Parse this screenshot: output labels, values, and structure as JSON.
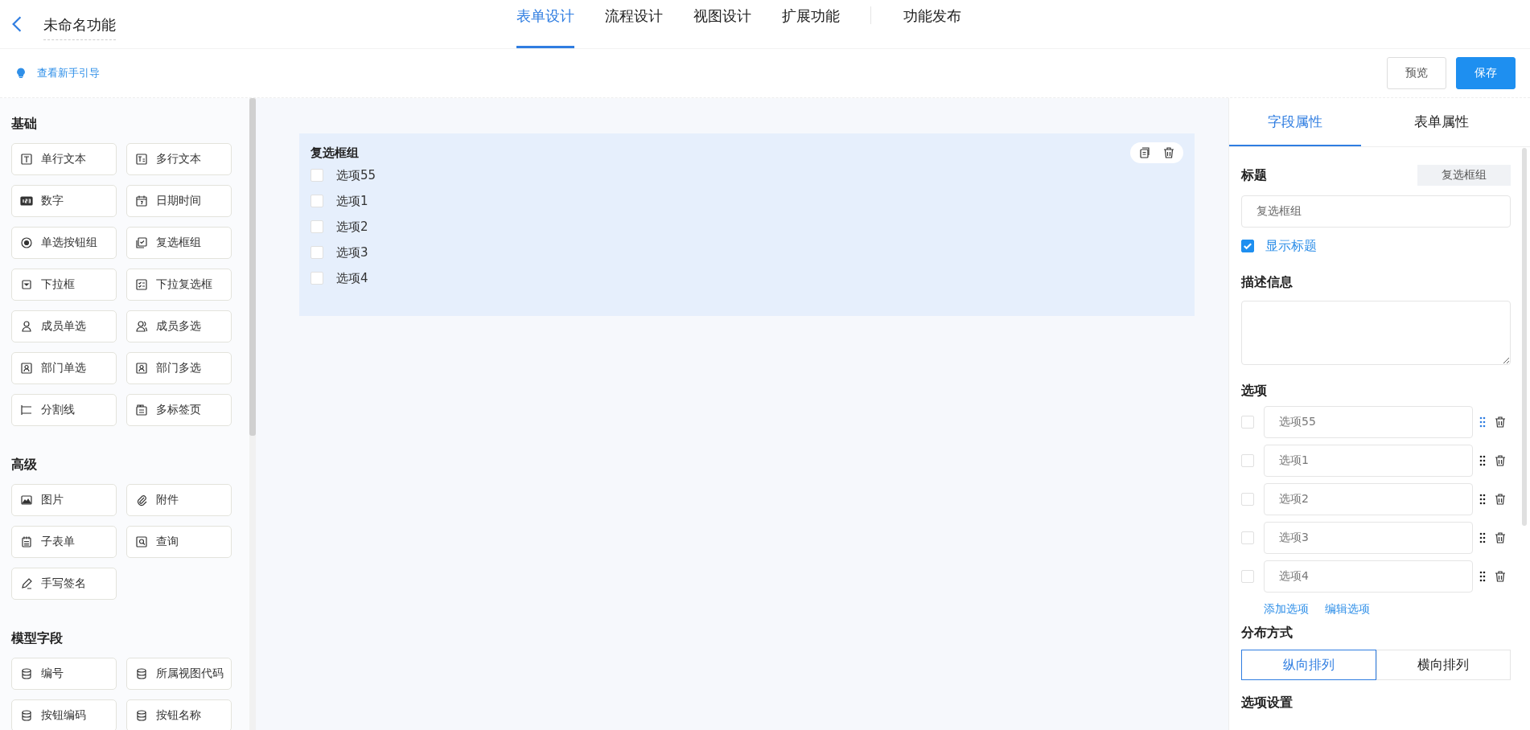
{
  "header": {
    "title": "未命名功能",
    "tabs": [
      {
        "label": "表单设计",
        "selected": true
      },
      {
        "label": "流程设计",
        "selected": false
      },
      {
        "label": "视图设计",
        "selected": false
      },
      {
        "label": "扩展功能",
        "selected": false
      }
    ],
    "publish": "功能发布"
  },
  "toolbar": {
    "guide_link": "查看新手引导",
    "buttons": [
      {
        "label": "预览",
        "kind": "default"
      },
      {
        "label": "保存",
        "kind": "primary"
      }
    ]
  },
  "palette": [
    {
      "heading": "基础",
      "items": [
        "单行文本",
        "多行文本",
        "数字",
        "日期时间",
        "单选按钮组",
        "复选框组",
        "下拉框",
        "下拉复选框",
        "成员单选",
        "成员多选",
        "部门单选",
        "部门多选",
        "分割线",
        "多标签页"
      ]
    },
    {
      "heading": "高级",
      "items": [
        "图片",
        "附件",
        "子表单",
        "查询",
        "手写签名"
      ]
    },
    {
      "heading": "模型字段",
      "items": [
        "编号",
        "所属视图代码",
        "按钮编码",
        "按钮名称"
      ]
    }
  ],
  "canvas": {
    "field": {
      "title": "复选框组",
      "options": [
        {
          "label": "选项55",
          "checked": false
        },
        {
          "label": "选项1",
          "checked": false
        },
        {
          "label": "选项2",
          "checked": false
        },
        {
          "label": "选项3",
          "checked": false
        },
        {
          "label": "选项4",
          "checked": false
        }
      ]
    }
  },
  "properties": {
    "tabs": [
      {
        "label": "字段属性",
        "selected": true
      },
      {
        "label": "表单属性",
        "selected": false
      }
    ],
    "title_label": "标题",
    "type_tag": "复选框组",
    "title_value": "复选框组",
    "show_title": {
      "label": "显示标题",
      "checked": true
    },
    "description_label": "描述信息",
    "options_label": "选项",
    "options": [
      {
        "value": "选项55",
        "checked": false,
        "highlighted": true
      },
      {
        "value": "选项1",
        "checked": false,
        "highlighted": false
      },
      {
        "value": "选项2",
        "checked": false,
        "highlighted": false
      },
      {
        "value": "选项3",
        "checked": false,
        "highlighted": false
      },
      {
        "value": "选项4",
        "checked": false,
        "highlighted": false
      }
    ],
    "add_option": "添加选项",
    "edit_options": "编辑选项",
    "layout_label": "分布方式",
    "layout": [
      {
        "label": "纵向排列",
        "selected": true
      },
      {
        "label": "横向排列",
        "selected": false
      }
    ],
    "option_settings_label": "选项设置"
  }
}
